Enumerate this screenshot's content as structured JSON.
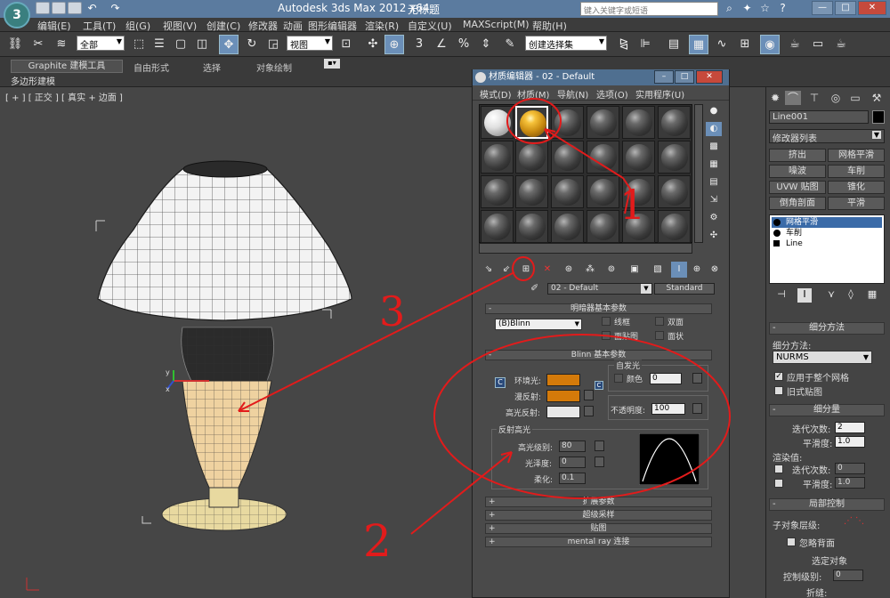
{
  "titlebar": {
    "app_title": "Autodesk 3ds Max  2012  x64",
    "doc_title": "无标题",
    "search_placeholder": "键入关键字或短语",
    "win_minimize": "—",
    "win_restore": "□",
    "win_close": "✕"
  },
  "menubar": {
    "logo": "3",
    "items": [
      "编辑(E)",
      "工具(T)",
      "组(G)",
      "视图(V)",
      "创建(C)",
      "修改器",
      "动画",
      "图形编辑器",
      "渲染(R)",
      "自定义(U)",
      "MAXScript(M)",
      "帮助(H)"
    ]
  },
  "toolbar": {
    "selection_filter": "全部",
    "ref_coord": "视图",
    "named_selection": "创建选择集"
  },
  "ribbon": {
    "tabs": [
      "Graphite 建模工具",
      "自由形式",
      "选择",
      "对象绘制"
    ],
    "sub_label": "多边形建模"
  },
  "viewport": {
    "label": "[ + ] [ 正交 ] [ 真实 + 边面 ]"
  },
  "material_editor": {
    "title": "材质编辑器 - 02 - Default",
    "menu": [
      "模式(D)",
      "材质(M)",
      "导航(N)",
      "选项(O)",
      "实用程序(U)"
    ],
    "material_name": "02 - Default",
    "material_type": "Standard",
    "shader_rollout": "明暗器基本参数",
    "shader_type": "(B)Blinn",
    "shader_options": [
      "线框",
      "双面",
      "面贴图",
      "面状"
    ],
    "blinn_rollout": "Blinn 基本参数",
    "self_illum_label": "自发光",
    "color_label": "颜色",
    "self_illum_value": "0",
    "ambient_label": "环境光:",
    "diffuse_label": "漫反射:",
    "specular_label": "高光反射:",
    "opacity_label": "不透明度:",
    "opacity_value": "100",
    "specular_group": "反射高光",
    "spec_level_label": "高光级别:",
    "spec_level_value": "80",
    "glossiness_label": "光泽度:",
    "glossiness_value": "0",
    "soften_label": "柔化:",
    "soften_value": "0.1",
    "collapsed_rollouts": [
      "扩展参数",
      "超级采样",
      "贴图",
      "mental ray 连接"
    ],
    "colors": {
      "ambient": "#d47a0a",
      "diffuse": "#d47a0a",
      "specular": "#e8e8e8"
    }
  },
  "command_panel": {
    "object_name": "Line001",
    "modifier_list": "修改器列表",
    "modifier_buttons": [
      "挤出",
      "网格平滑",
      "噪波",
      "车削",
      "UVW 贴图",
      "锥化",
      "倒角剖面",
      "平滑"
    ],
    "stack": [
      "网格平滑",
      "车削",
      "Line"
    ],
    "subdivision_method_rollout": "细分方法",
    "subdivision_method_label": "细分方法:",
    "subdivision_method_value": "NURMS",
    "apply_whole_mesh": "应用于整个网格",
    "old_style_mapping": "旧式贴图",
    "subdivision_amount_rollout": "细分量",
    "iterations_label": "迭代次数:",
    "iterations_value": "2",
    "smoothness_label": "平滑度:",
    "smoothness_value": "1.0",
    "render_values_label": "渲染值:",
    "render_iterations_label": "迭代次数:",
    "render_iterations_value": "0",
    "render_smoothness_label": "平滑度:",
    "render_smoothness_value": "1.0",
    "local_control_rollout": "局部控制",
    "subobject_level_label": "子对象层级:",
    "ignore_backfacing": "忽略背面",
    "selected_objects": "选定对象",
    "control_level_label": "控制级别:",
    "control_level_value": "0",
    "crease_label": "折缝:"
  },
  "annotations": [
    "1",
    "2",
    "3"
  ]
}
